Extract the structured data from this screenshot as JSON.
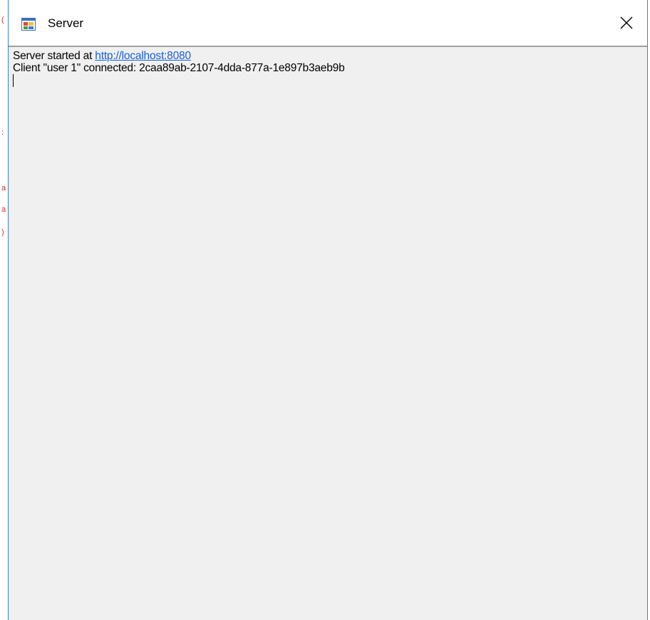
{
  "window": {
    "title": "Server",
    "app_icon": "windows-form-icon",
    "close_icon": "close-icon"
  },
  "log": {
    "line1_prefix": "Server started at ",
    "line1_link": "http://localhost:8080",
    "line2": "Client \"user 1\" connected: 2caa89ab-2107-4dda-877a-1e897b3aeb9b"
  },
  "colors": {
    "client_background": "#f0f0f0",
    "link": "#1a5fd6",
    "window_border": "#3c7fd1"
  }
}
